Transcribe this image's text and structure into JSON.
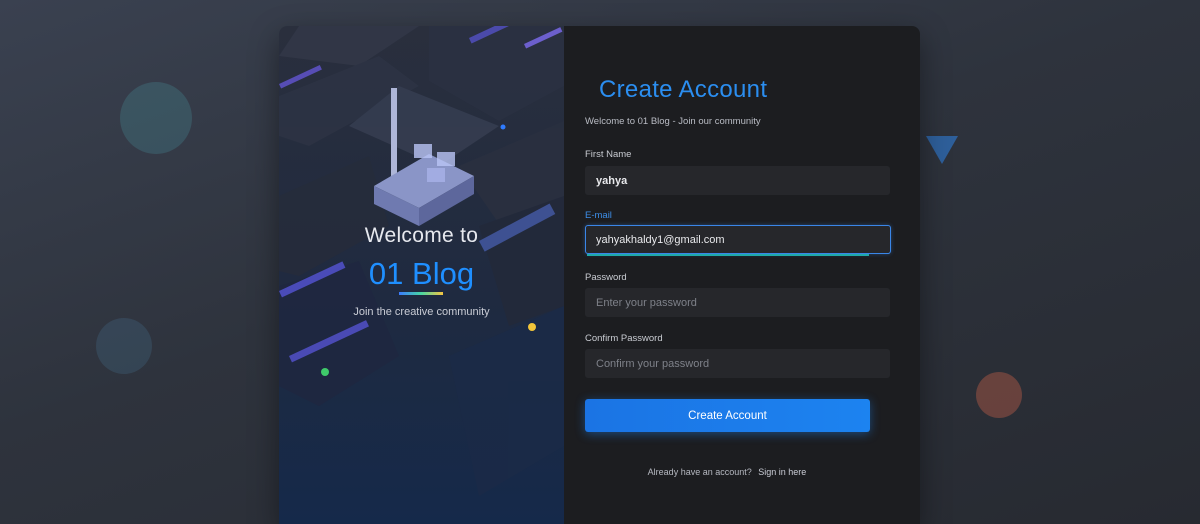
{
  "colors": {
    "accent": "#1c83f0",
    "title": "#2b8ef0",
    "panel": "#1c1d20",
    "field": "#26272b"
  },
  "hero": {
    "welcome": "Welcome to",
    "brand": "01 Blog",
    "tagline": "Join the creative community"
  },
  "form": {
    "title": "Create Account",
    "subtitle": "Welcome to 01 Blog - Join our community",
    "first_name": {
      "label": "First Name",
      "value": "yahya"
    },
    "email": {
      "label": "E-mail",
      "value": "yahyakhaldy1@gmail.com"
    },
    "password": {
      "label": "Password",
      "placeholder": "Enter your password",
      "value": ""
    },
    "confirm_password": {
      "label": "Confirm Password",
      "placeholder": "Confirm your password",
      "value": ""
    },
    "submit_label": "Create Account",
    "signin_prompt": "Already have an account?",
    "signin_link": "Sign in here"
  }
}
